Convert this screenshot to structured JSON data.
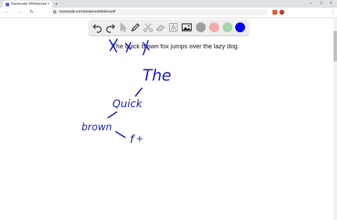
{
  "browser": {
    "tab": {
      "title": "Numerade Whiteboard",
      "close_glyph": "×",
      "favicon": "numerade-favicon-icon"
    },
    "new_tab_glyph": "+",
    "window_buttons": {
      "minimize": "–",
      "maximize": "□",
      "close": "×"
    },
    "nav": {
      "back": "←",
      "forward": "→",
      "reload": "↻"
    },
    "url": "numerade.com/answers/whiteboard/",
    "menu_glyph": "⋮",
    "icons": {
      "lock": "lock-icon",
      "extension_1": "red-extension-icon",
      "extension_2": "profile-icon"
    }
  },
  "palette": {
    "tools": [
      "undo-icon",
      "redo-icon",
      "select-pointer-icon",
      "pen-icon",
      "scissors-icon",
      "eraser-icon",
      "text-icon",
      "image-icon"
    ],
    "colors": [
      "#9e9e9e",
      "#f4a9aa",
      "#a5d6a7",
      "#0000ff"
    ],
    "selected_color": "#0000ff"
  },
  "whiteboard": {
    "sentence": "The quick brown fox jumps over the lazy dog.",
    "handwriting": {
      "words": [
        "The",
        "Quick",
        "brown",
        "f"
      ],
      "color": "#1a1acc"
    }
  }
}
